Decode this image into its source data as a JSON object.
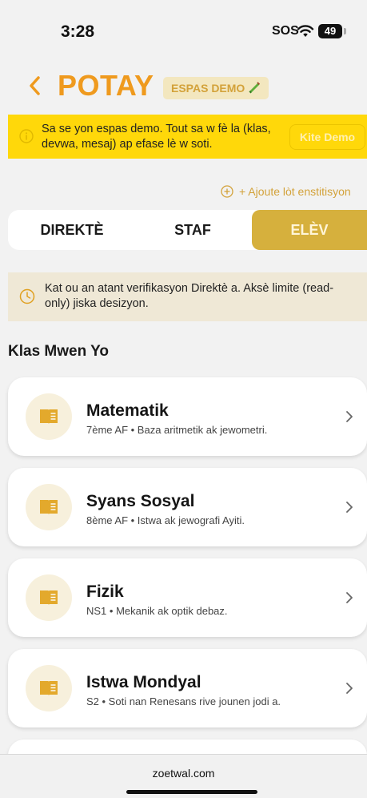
{
  "status_bar": {
    "time": "3:28",
    "sos": "SOS",
    "battery": "49"
  },
  "header": {
    "back_icon": "chevron-left-icon",
    "title": "POTAY",
    "badge_label": "ESPAS DEMO",
    "badge_icon": "test-tube-icon",
    "brand_color": "#ef9a1e"
  },
  "demo_banner": {
    "text": "Sa se yon espas demo. Tout sa w fè la (klas, devwa, mesaj) ap efase lè w soti.",
    "exit_button": "Kite Demo",
    "background": "#ffd80a"
  },
  "add_institution": {
    "label": "+ Ajoute lòt enstitisyon"
  },
  "role_tabs": {
    "items": [
      {
        "label": "DIREKTÈ",
        "selected": false
      },
      {
        "label": "STAF",
        "selected": false
      },
      {
        "label": "ELÈV",
        "selected": true
      }
    ],
    "active_color": "#d6b03d"
  },
  "pending_notice": {
    "text": "Kat ou an atant verifikasyon Direktè a. Aksè limite (read-only) jiska desizyon."
  },
  "classes": {
    "section_title": "Klas Mwen Yo",
    "items": [
      {
        "title": "Matematik",
        "subtitle": "7ème AF • Baza aritmetik ak jewometri."
      },
      {
        "title": "Syans Sosyal",
        "subtitle": "8ème AF • Istwa ak jewografi Ayiti."
      },
      {
        "title": "Fizik",
        "subtitle": "NS1 • Mekanik ak optik debaz."
      },
      {
        "title": "Istwa Mondyal",
        "subtitle": "S2 • Soti nan Renesans rive jounen jodi a."
      }
    ]
  },
  "browser": {
    "url": "zoetwal.com"
  }
}
